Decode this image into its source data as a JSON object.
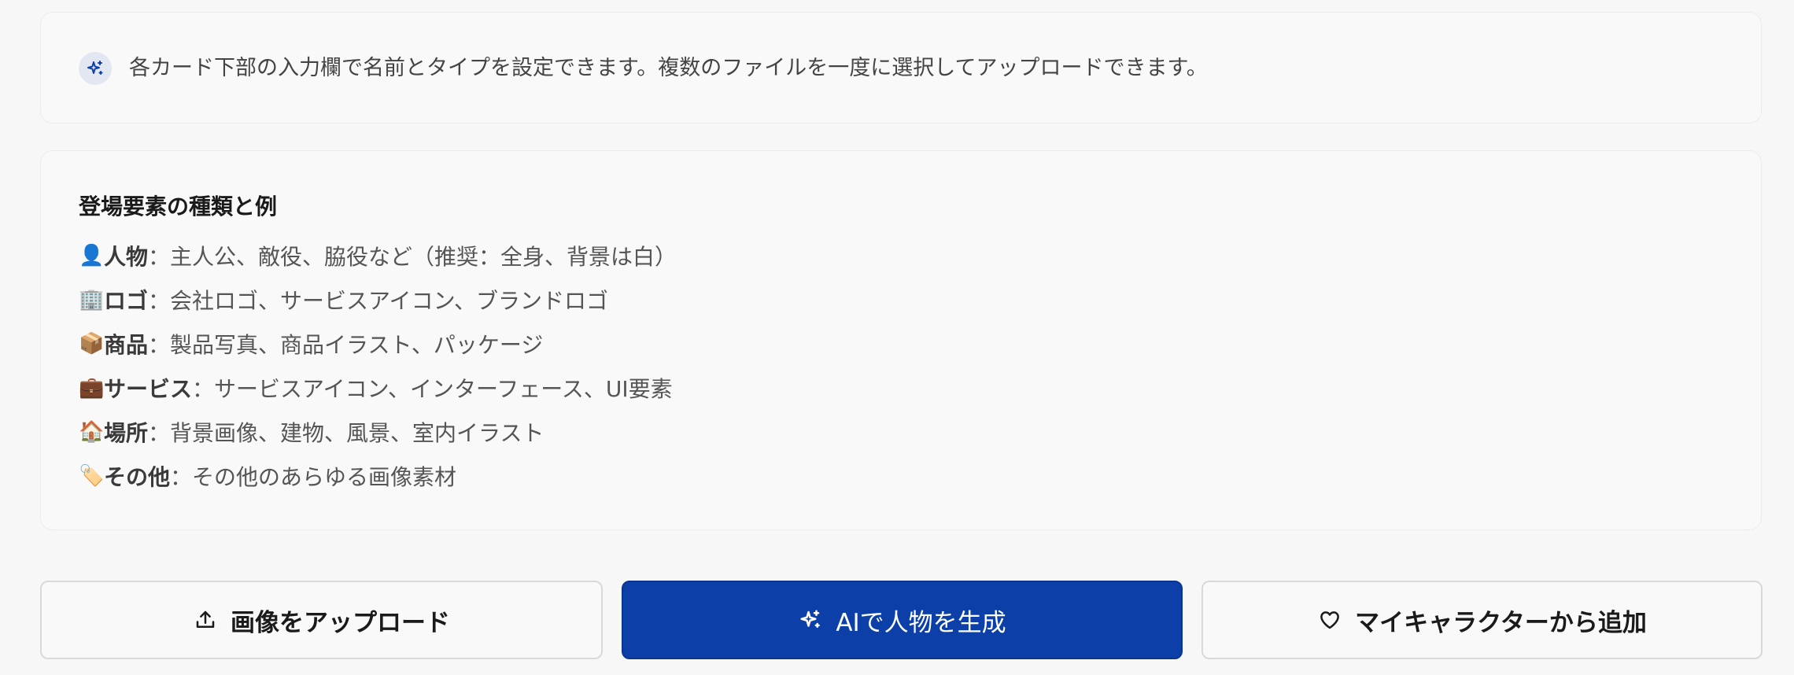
{
  "tip": {
    "icon": "sparkles-icon",
    "text": "各カード下部の入力欄で名前とタイプを設定できます。複数のファイルを一度に選択してアップロードできます。"
  },
  "types_card": {
    "title": "登場要素の種類と例",
    "items": [
      {
        "emoji": "👤",
        "name": "人物",
        "sep": "：",
        "desc": "主人公、敵役、脇役など（推奨：全身、背景は白）"
      },
      {
        "emoji": "🏢",
        "name": "ロゴ",
        "sep": "：",
        "desc": "会社ロゴ、サービスアイコン、ブランドロゴ"
      },
      {
        "emoji": "📦",
        "name": "商品",
        "sep": "：",
        "desc": "製品写真、商品イラスト、パッケージ"
      },
      {
        "emoji": "💼",
        "name": "サービス",
        "sep": "：",
        "desc": "サービスアイコン、インターフェース、UI要素"
      },
      {
        "emoji": "🏠",
        "name": "場所",
        "sep": "：",
        "desc": "背景画像、建物、風景、室内イラスト"
      },
      {
        "emoji": "🏷️",
        "name": "その他",
        "sep": "：",
        "desc": "その他のあらゆる画像素材"
      }
    ]
  },
  "actions": {
    "upload_label": "画像をアップロード",
    "upload_icon": "upload-icon",
    "ai_label": "AIで人物を生成",
    "ai_icon": "sparkles-icon",
    "fav_label": "マイキャラクターから追加",
    "fav_icon": "heart-icon"
  },
  "colors": {
    "primary": "#0c3fa7",
    "tip_icon_bg": "#e3e7f1",
    "background": "#f7f7f7"
  }
}
